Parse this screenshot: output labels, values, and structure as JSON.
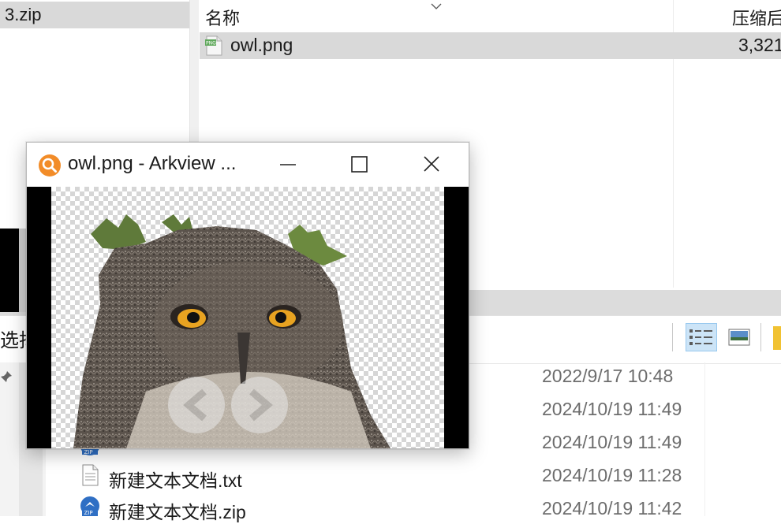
{
  "archive": {
    "tree_item": "3.zip",
    "columns": {
      "name": "名称",
      "compressed": "压缩后"
    },
    "file": {
      "name": "owl.png",
      "compressed_size": "3,321"
    }
  },
  "arkview": {
    "title": "owl.png - Arkview ...",
    "icons": {
      "app": "magnifier-icon",
      "minimize": "minimize-icon",
      "maximize": "maximize-icon",
      "close": "close-icon"
    },
    "image_subject": "owl"
  },
  "explorer": {
    "toolbar": {
      "select_label": "选择"
    },
    "rows": [
      {
        "name": "",
        "date": "2022/9/17 10:48",
        "icon": ""
      },
      {
        "name": "",
        "date": "2024/10/19 11:49",
        "icon": ""
      },
      {
        "name": "",
        "date": "2024/10/19 11:49",
        "icon": "zip-file-icon"
      },
      {
        "name": "新建文本文档.txt",
        "date": "2024/10/19 11:28",
        "icon": "text-file-icon"
      },
      {
        "name": "新建文本文档.zip",
        "date": "2024/10/19 11:42",
        "icon": "zip-file-icon"
      }
    ]
  },
  "colors": {
    "selection": "#d9d9d9",
    "date_text": "#6d6d6d",
    "arkview_icon": "#f28c28",
    "view_button_active": "#cce4f7"
  }
}
